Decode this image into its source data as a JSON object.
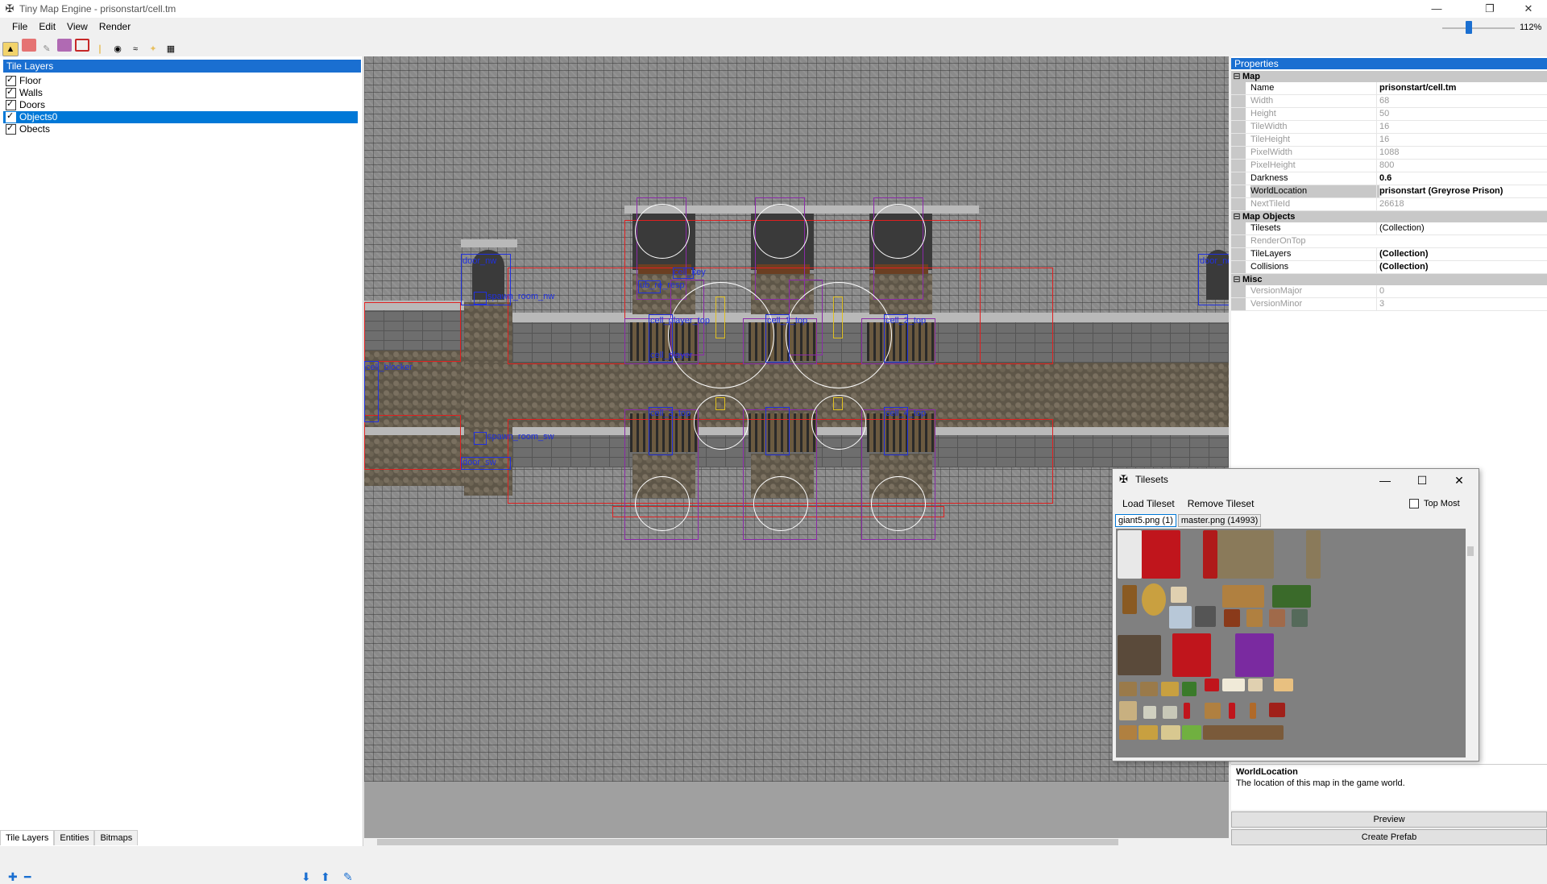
{
  "window": {
    "title": "Tiny Map Engine - prisonstart/cell.tm",
    "minimize": "—",
    "restore": "❐",
    "close": "✕"
  },
  "menu": [
    "File",
    "Edit",
    "View",
    "Render"
  ],
  "toolbar_icons": [
    "layer-tool-icon",
    "eraser-icon",
    "stamp-icon",
    "object-icon",
    "select-icon",
    "light-icon",
    "eye-icon",
    "entity-icon",
    "lamp-icon",
    "grid-icon"
  ],
  "zoom": {
    "value_label": "112%",
    "level": 0.35
  },
  "tile_layers": {
    "header": "Tile Layers",
    "items": [
      {
        "label": "Floor",
        "checked": true,
        "selected": false
      },
      {
        "label": "Walls",
        "checked": true,
        "selected": false
      },
      {
        "label": "Doors",
        "checked": true,
        "selected": false
      },
      {
        "label": "Objects0",
        "checked": true,
        "selected": true
      },
      {
        "label": "Obects",
        "checked": true,
        "selected": false
      }
    ]
  },
  "left_tabs": [
    "Tile Layers",
    "Entities",
    "Bitmaps"
  ],
  "map_labels": {
    "door_nw": "door_nw",
    "door_ne": "door_ne",
    "spawn_room_nw": "spawn_room_nw",
    "spawn_room_sw": "spawn_room_sw",
    "door_sw": "door_sw",
    "cell_blocker": "cell_blocker",
    "cell_key": "cell_key",
    "ub_resp": "ub_re_resp",
    "cell_player_top": "cell_player_top",
    "cell_player": "cell_player",
    "cell_1_top": "cell_1_top",
    "cell_2_top": "cell_2_top",
    "cell_3_top": "cell_3_top",
    "cell_4_top": "cell_4_top"
  },
  "properties": {
    "header": "Properties",
    "categories": [
      {
        "name": "Map",
        "rows": [
          {
            "name": "Name",
            "value": "prisonstart/cell.tm",
            "bold": true,
            "readonly": false
          },
          {
            "name": "Width",
            "value": "68",
            "readonly": true
          },
          {
            "name": "Height",
            "value": "50",
            "readonly": true
          },
          {
            "name": "TileWidth",
            "value": "16",
            "readonly": true
          },
          {
            "name": "TileHeight",
            "value": "16",
            "readonly": true
          },
          {
            "name": "PixelWidth",
            "value": "1088",
            "readonly": true
          },
          {
            "name": "PixelHeight",
            "value": "800",
            "readonly": true
          },
          {
            "name": "Darkness",
            "value": "0.6",
            "bold": true
          },
          {
            "name": "WorldLocation",
            "value": "prisonstart (Greyrose Prison)",
            "bold": true,
            "selected": true
          },
          {
            "name": "NextTileId",
            "value": "26618",
            "readonly": true
          }
        ]
      },
      {
        "name": "Map Objects",
        "rows": [
          {
            "name": "Tilesets",
            "value": "(Collection)"
          },
          {
            "name": "RenderOnTop",
            "value": "",
            "readonly": true
          },
          {
            "name": "TileLayers",
            "value": "(Collection)",
            "bold": true
          },
          {
            "name": "Collisions",
            "value": "(Collection)",
            "bold": true
          }
        ]
      },
      {
        "name": "Misc",
        "rows": [
          {
            "name": "VersionMajor",
            "value": "0",
            "readonly": true
          },
          {
            "name": "VersionMinor",
            "value": "3",
            "readonly": true
          }
        ]
      }
    ],
    "description_title": "WorldLocation",
    "description_text": "The location of this map in the game world.",
    "preview_button": "Preview",
    "create_prefab_button": "Create Prefab"
  },
  "tilesets_window": {
    "title": "Tilesets",
    "load": "Load Tileset",
    "remove": "Remove Tileset",
    "top_most": "Top Most",
    "tabs": [
      "giant5.png (1)",
      "master.png (14993)"
    ]
  }
}
